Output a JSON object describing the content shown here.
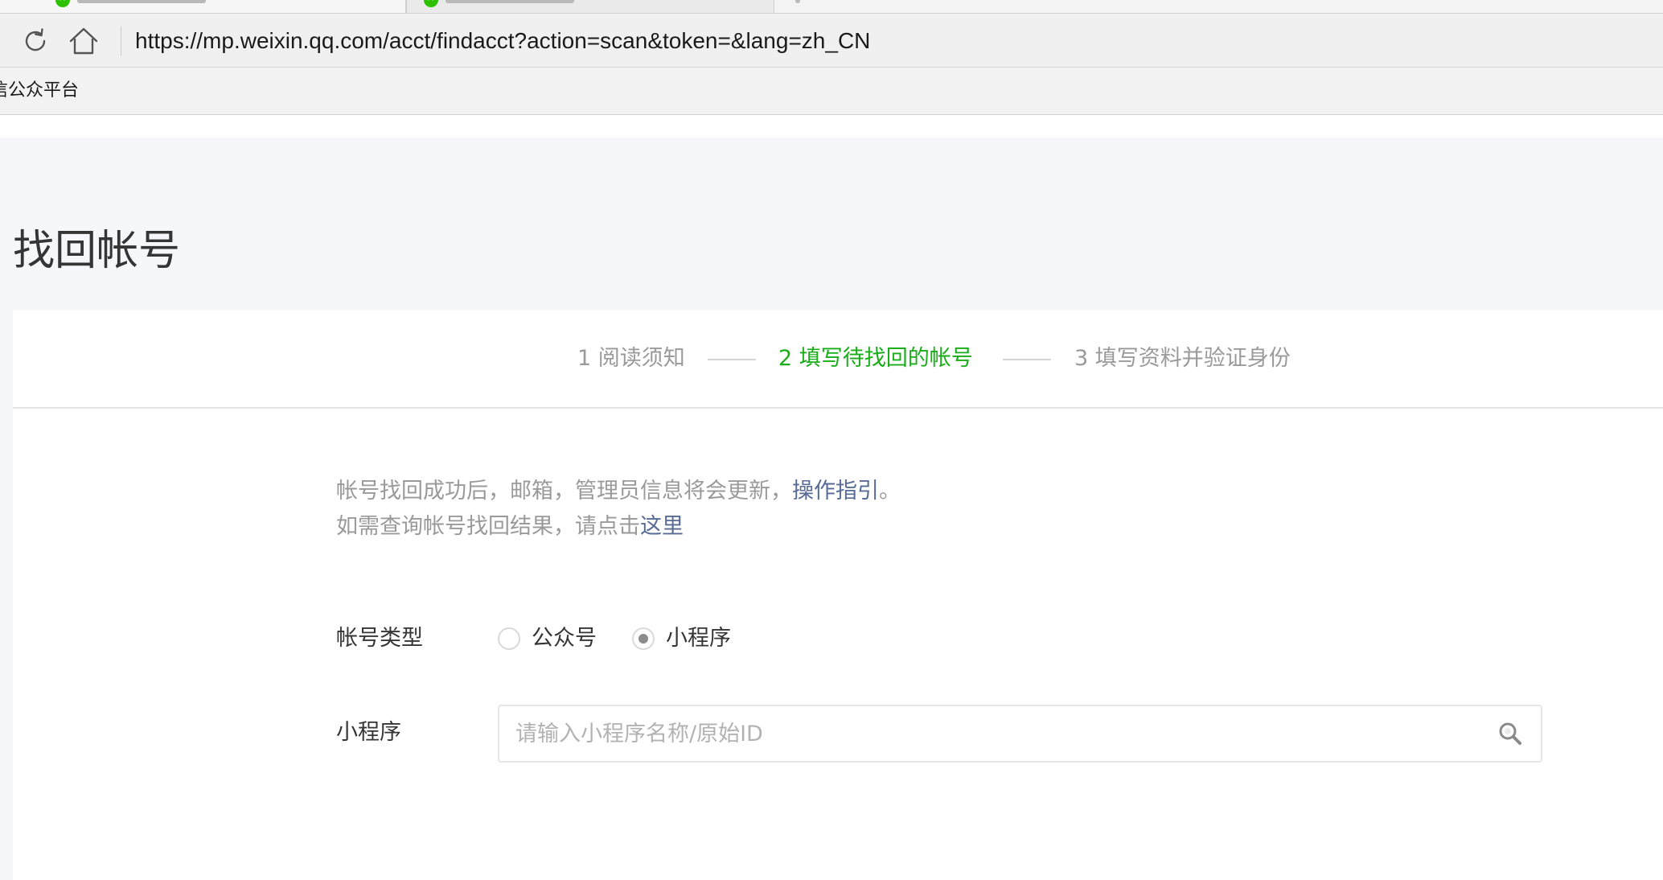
{
  "browser": {
    "url": "https://mp.weixin.qq.com/acct/findacct?action=scan&token=&lang=zh_CN",
    "bookmark": "信公众平台"
  },
  "page": {
    "title": "找回帐号"
  },
  "steps": [
    {
      "label": "1 阅读须知"
    },
    {
      "label": "2 填写待找回的帐号"
    },
    {
      "label": "3 填写资料并验证身份"
    }
  ],
  "notice": {
    "line1_prefix": "帐号找回成功后，邮箱，管理员信息将会更新，",
    "line1_link": "操作指引",
    "line1_suffix": "。",
    "line2_prefix": "如需查询帐号找回结果，请点击",
    "line2_link": "这里"
  },
  "form": {
    "account_type_label": "帐号类型",
    "options": [
      {
        "label": "公众号",
        "checked": false
      },
      {
        "label": "小程序",
        "checked": true
      }
    ],
    "mini_program_label": "小程序",
    "search_placeholder": "请输入小程序名称/原始ID",
    "search_value": ""
  },
  "colors": {
    "active_step": "#1aad19",
    "link": "#576b95",
    "muted_text": "#9a9a9a",
    "page_bg": "#f6f7f8"
  },
  "icons": {
    "reload": "reload-icon",
    "home": "home-icon",
    "search": "search-icon",
    "favicon": "wechat-favicon-icon"
  }
}
